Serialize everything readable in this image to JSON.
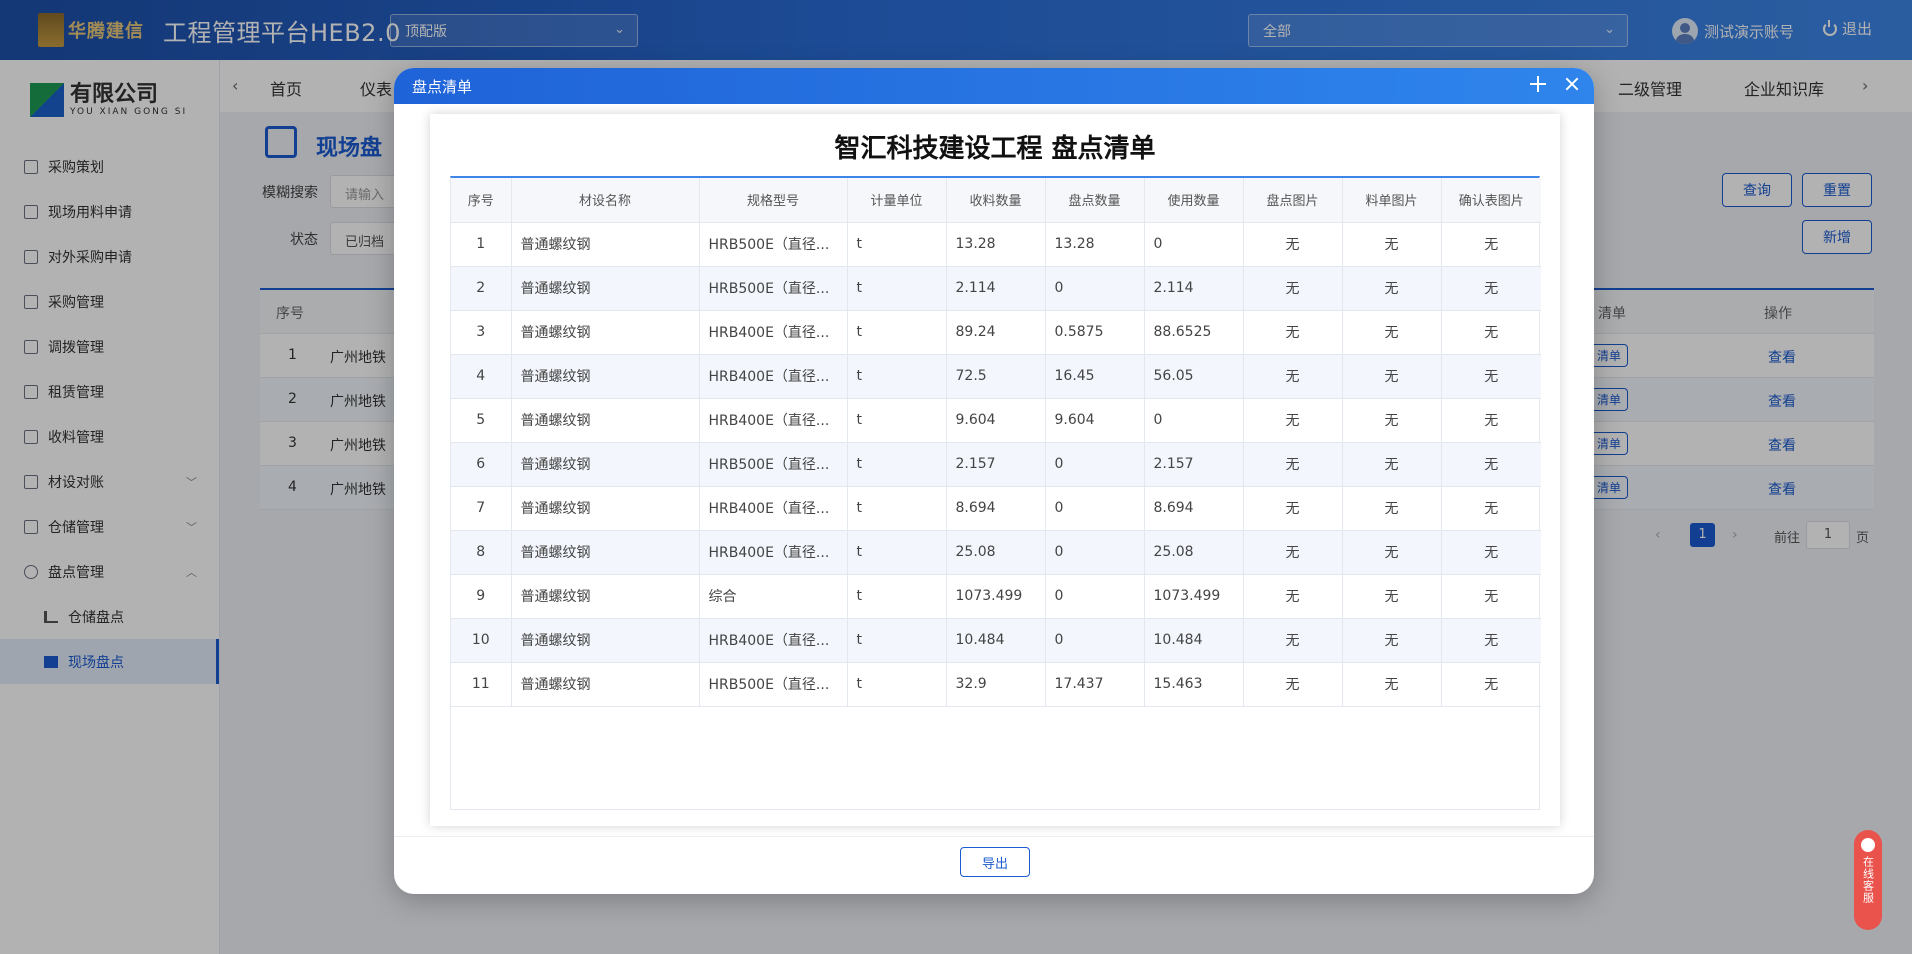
{
  "header": {
    "app_title": "工程管理平台HEB2.0",
    "logo_text": "华腾建信",
    "version_select": "顶配版",
    "scope_select": "全部",
    "user_name": "测试演示账号",
    "logout_label": "退出"
  },
  "sidebar": {
    "brand_cn": "有限公司",
    "brand_en": "YOU XIAN GONG SI",
    "items": [
      {
        "label": "采购策划"
      },
      {
        "label": "现场用料申请"
      },
      {
        "label": "对外采购申请"
      },
      {
        "label": "采购管理"
      },
      {
        "label": "调拨管理"
      },
      {
        "label": "租赁管理"
      },
      {
        "label": "收料管理"
      },
      {
        "label": "材设对账"
      },
      {
        "label": "仓储管理"
      },
      {
        "label": "盘点管理"
      }
    ],
    "sub_items": [
      {
        "label": "仓储盘点"
      },
      {
        "label": "现场盘点"
      }
    ]
  },
  "tabs": {
    "home": "首页",
    "dash": "仪表",
    "level2": "二级管理",
    "knowledge": "企业知识库"
  },
  "page": {
    "title": "现场盘",
    "search_label": "模糊搜索",
    "search_placeholder": "请输入",
    "status_label": "状态",
    "status_value": "已归档",
    "query_btn": "查询",
    "reset_btn": "重置",
    "add_btn": "新增",
    "table_head_no": "序号",
    "table_head_list": "清单",
    "table_head_op": "操作",
    "rows": [
      {
        "no": "1",
        "name": "广州地铁",
        "tag": "清单",
        "op": "查看"
      },
      {
        "no": "2",
        "name": "广州地铁",
        "tag": "清单",
        "op": "查看"
      },
      {
        "no": "3",
        "name": "广州地铁",
        "tag": "清单",
        "op": "查看"
      },
      {
        "no": "4",
        "name": "广州地铁",
        "tag": "清单",
        "op": "查看"
      }
    ],
    "pager_current": "1",
    "pager_goto": "前往",
    "pager_page": "1",
    "pager_suffix": "页"
  },
  "modal": {
    "title": "盘点清单",
    "doc_title": "智汇科技建设工程 盘点清单",
    "columns": [
      "序号",
      "材设名称",
      "规格型号",
      "计量单位",
      "收料数量",
      "盘点数量",
      "使用数量",
      "盘点图片",
      "料单图片",
      "确认表图片"
    ],
    "rows": [
      [
        "1",
        "普通螺纹钢",
        "HRB500E（直径...",
        "t",
        "13.28",
        "13.28",
        "0",
        "无",
        "无",
        "无"
      ],
      [
        "2",
        "普通螺纹钢",
        "HRB500E（直径...",
        "t",
        "2.114",
        "0",
        "2.114",
        "无",
        "无",
        "无"
      ],
      [
        "3",
        "普通螺纹钢",
        "HRB400E（直径...",
        "t",
        "89.24",
        "0.5875",
        "88.6525",
        "无",
        "无",
        "无"
      ],
      [
        "4",
        "普通螺纹钢",
        "HRB400E（直径...",
        "t",
        "72.5",
        "16.45",
        "56.05",
        "无",
        "无",
        "无"
      ],
      [
        "5",
        "普通螺纹钢",
        "HRB400E（直径...",
        "t",
        "9.604",
        "9.604",
        "0",
        "无",
        "无",
        "无"
      ],
      [
        "6",
        "普通螺纹钢",
        "HRB500E（直径...",
        "t",
        "2.157",
        "0",
        "2.157",
        "无",
        "无",
        "无"
      ],
      [
        "7",
        "普通螺纹钢",
        "HRB400E（直径...",
        "t",
        "8.694",
        "0",
        "8.694",
        "无",
        "无",
        "无"
      ],
      [
        "8",
        "普通螺纹钢",
        "HRB400E（直径...",
        "t",
        "25.08",
        "0",
        "25.08",
        "无",
        "无",
        "无"
      ],
      [
        "9",
        "普通螺纹钢",
        "综合",
        "t",
        "1073.499",
        "0",
        "1073.499",
        "无",
        "无",
        "无"
      ],
      [
        "10",
        "普通螺纹钢",
        "HRB400E（直径...",
        "t",
        "10.484",
        "0",
        "10.484",
        "无",
        "无",
        "无"
      ],
      [
        "11",
        "普通螺纹钢",
        "HRB500E（直径...",
        "t",
        "32.9",
        "17.437",
        "15.463",
        "无",
        "无",
        "无"
      ]
    ],
    "export_btn": "导出"
  },
  "service": {
    "label": "在线客服"
  },
  "colors": {
    "accent": "#1a5bd0",
    "header": "#2a6cd6"
  }
}
